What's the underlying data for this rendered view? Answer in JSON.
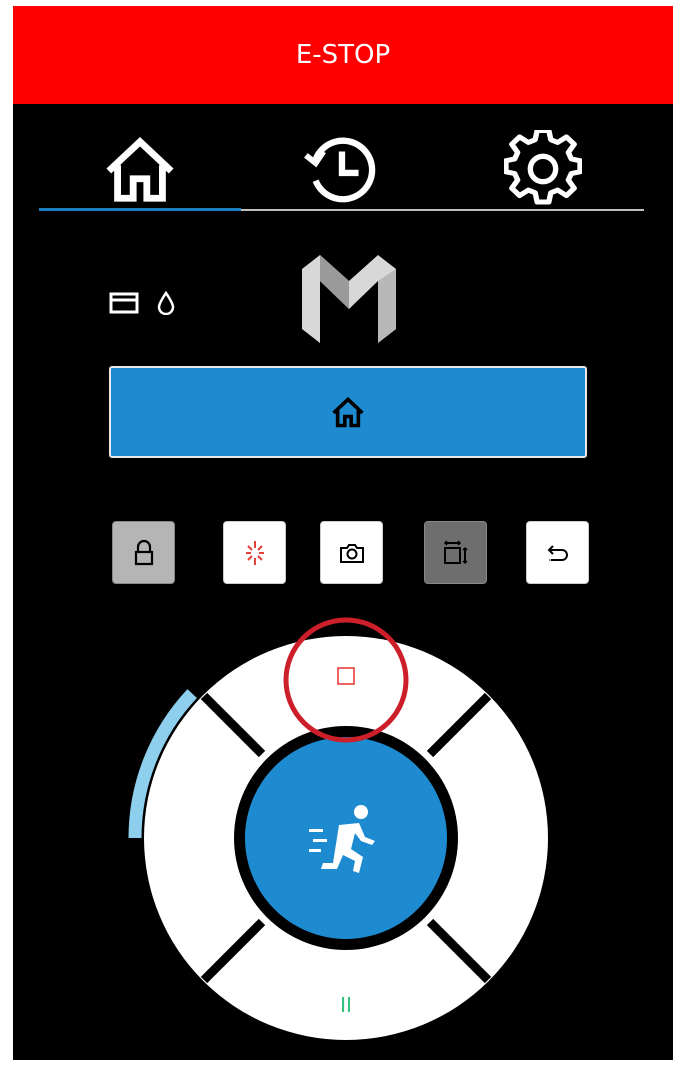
{
  "estop": {
    "label": "E-STOP",
    "color": "#ff0000"
  },
  "tabs": [
    {
      "icon": "home-icon",
      "active": true
    },
    {
      "icon": "history-icon",
      "active": false
    },
    {
      "icon": "settings-icon",
      "active": false
    }
  ],
  "colors": {
    "accent": "#1e8bd0",
    "progress_arc": "#8fcfee",
    "stop_red": "#e8403a",
    "pause_green": "#2ec27e",
    "highlight_ring": "#cc1f2a",
    "tab_underline": "#1e7fc0"
  },
  "status_icons": [
    "card-icon",
    "droplet-icon"
  ],
  "logo": "m-logo",
  "home_button": {
    "icon": "home-icon"
  },
  "toolbar": [
    {
      "icon": "lock-icon",
      "state": "active",
      "bg": "#b5b5b5"
    },
    {
      "icon": "laser-icon",
      "state": "normal",
      "bg": "#ffffff"
    },
    {
      "icon": "camera-icon",
      "state": "normal",
      "bg": "#ffffff"
    },
    {
      "icon": "resize-icon",
      "state": "active",
      "bg": "#6e6e6e"
    },
    {
      "icon": "return-icon",
      "state": "normal",
      "bg": "#ffffff"
    }
  ],
  "jog": {
    "top_icon": "stop-icon",
    "bottom_label": "II",
    "center_icon": "run-icon",
    "progress_fraction": 0.12
  }
}
